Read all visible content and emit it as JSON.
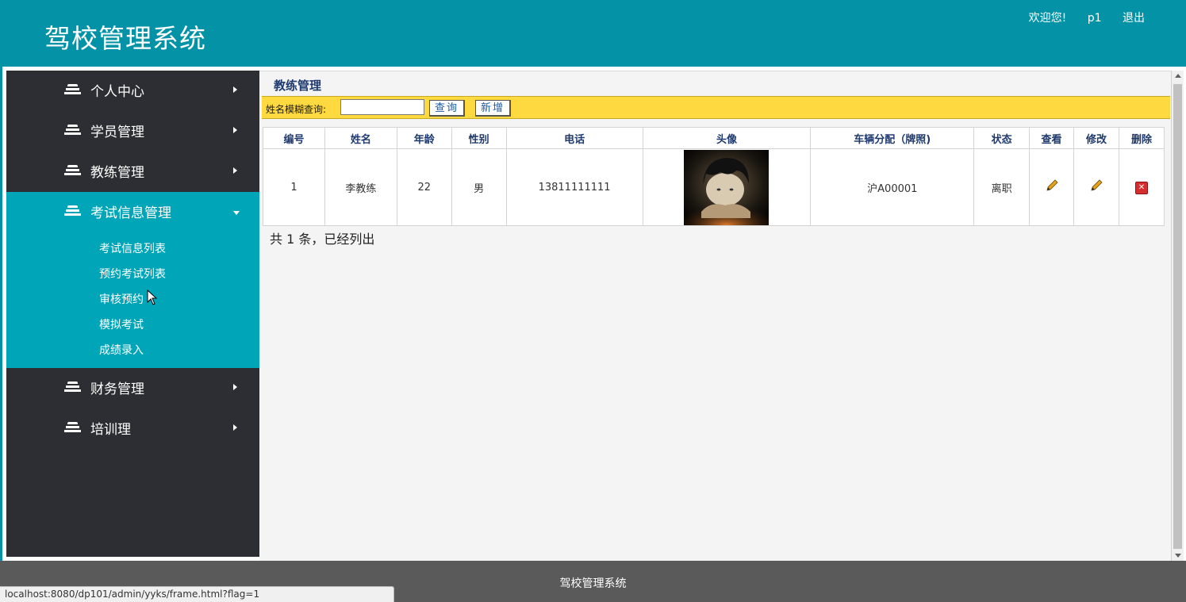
{
  "header": {
    "title": "驾校管理系统",
    "welcome": "欢迎您!",
    "username": "p1",
    "logout": "退出"
  },
  "sidebar": {
    "items": [
      {
        "label": "个人中心"
      },
      {
        "label": "学员管理"
      },
      {
        "label": "教练管理"
      },
      {
        "label": "考试信息管理"
      },
      {
        "label": "财务管理"
      },
      {
        "label": "培训理"
      }
    ],
    "submenu": [
      {
        "label": "考试信息列表"
      },
      {
        "label": "预约考试列表"
      },
      {
        "label": "审核预约"
      },
      {
        "label": "模拟考试"
      },
      {
        "label": "成绩录入"
      }
    ]
  },
  "main": {
    "page_title": "教练管理",
    "search": {
      "label": "姓名模糊查询:",
      "value": "",
      "query_button": "查询",
      "add_button": "新增"
    },
    "table": {
      "headers": [
        "编号",
        "姓名",
        "年龄",
        "性别",
        "电话",
        "头像",
        "车辆分配（牌照)",
        "状态",
        "查看",
        "修改",
        "删除"
      ],
      "rows": [
        {
          "id": "1",
          "name": "李教练",
          "age": "22",
          "gender": "男",
          "phone": "13811111111",
          "plate": "沪A00001",
          "status": "离职"
        }
      ]
    },
    "summary": "共 1 条，已经列出"
  },
  "footer": {
    "text": "驾校管理系统"
  },
  "statusbar": {
    "url": "localhost:8080/dp101/admin/yyks/frame.html?flag=1"
  },
  "colors": {
    "header_bg": "#0492a6",
    "sidebar_bg": "#2d2e33",
    "sidebar_active": "#00a5b8",
    "searchbar_bg": "#fed93f",
    "footer_bg": "#5a5a5a"
  },
  "icons": {
    "nav": "stack-icon",
    "view": "pencil-icon",
    "edit": "pencil-icon",
    "delete": "delete-icon"
  }
}
